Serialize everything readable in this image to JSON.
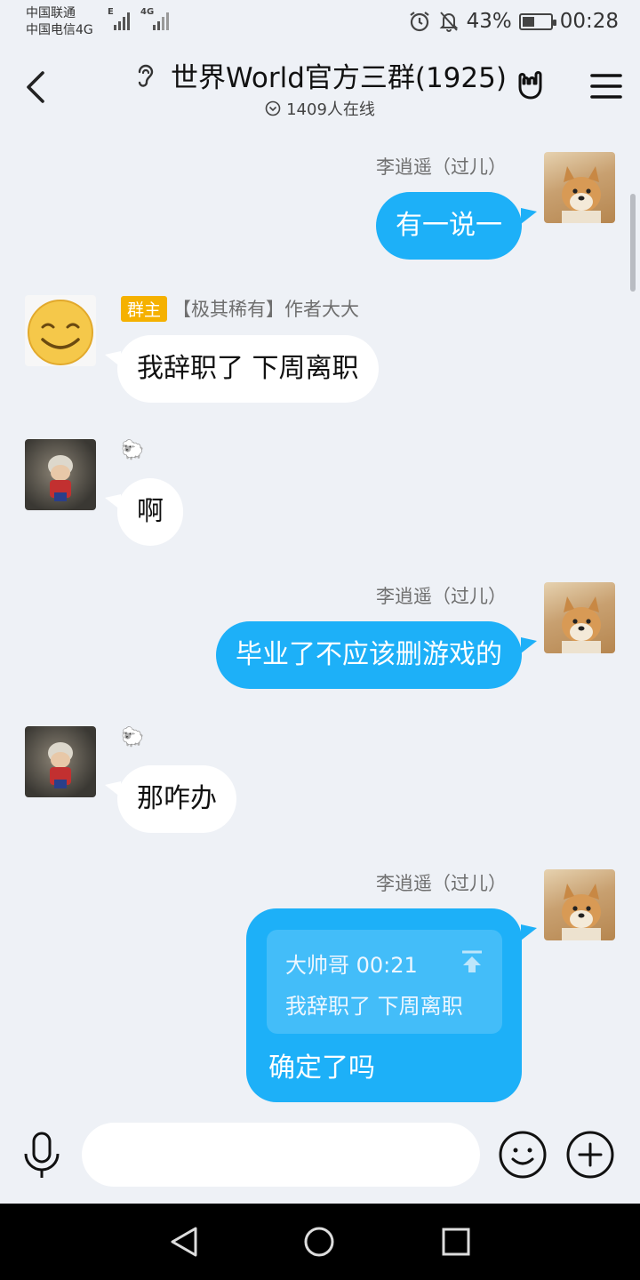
{
  "status_bar": {
    "carrier1": "中国联通",
    "carrier2": "中国电信4G",
    "signal1_type": "E",
    "signal2_type": "4G",
    "battery": "43%",
    "battery_level": 0.43,
    "time": "00:28",
    "icons": [
      "alarm-icon",
      "bell-off-icon",
      "battery-charging-icon"
    ]
  },
  "header": {
    "title": "世界World官方三群(1925)",
    "online": "1409人在线",
    "icons": [
      "back-arrow-icon",
      "ear-icon",
      "chevron-down-circle-icon",
      "rock-hand-icon",
      "menu-icon"
    ]
  },
  "messages": [
    {
      "side": "right",
      "sender": "李逍遥（过儿）",
      "text": "有一说一"
    },
    {
      "side": "left",
      "role_badge": "群主",
      "sender": "【极其稀有】作者大大",
      "text": "我辞职了 下周离职"
    },
    {
      "side": "left",
      "sender": "🐑",
      "text": "啊"
    },
    {
      "side": "right",
      "sender": "李逍遥（过儿）",
      "text": "毕业了不应该删游戏的"
    },
    {
      "side": "left",
      "sender": "🐑",
      "text": "那咋办"
    },
    {
      "side": "right",
      "sender": "李逍遥（过儿）",
      "quote": {
        "author_time": "大帅哥 00:21",
        "text": "我辞职了 下周离职"
      },
      "text": "确定了吗"
    }
  ],
  "input_bar": {
    "placeholder": "",
    "icons": [
      "microphone-icon",
      "emoji-icon",
      "plus-circle-icon"
    ]
  },
  "nav_bar": {
    "icons": [
      "nav-back-icon",
      "nav-home-icon",
      "nav-recent-icon"
    ]
  },
  "colors": {
    "accent_blue": "#1db0f8",
    "background": "#eef1f6",
    "owner_badge": "#f5b100"
  }
}
